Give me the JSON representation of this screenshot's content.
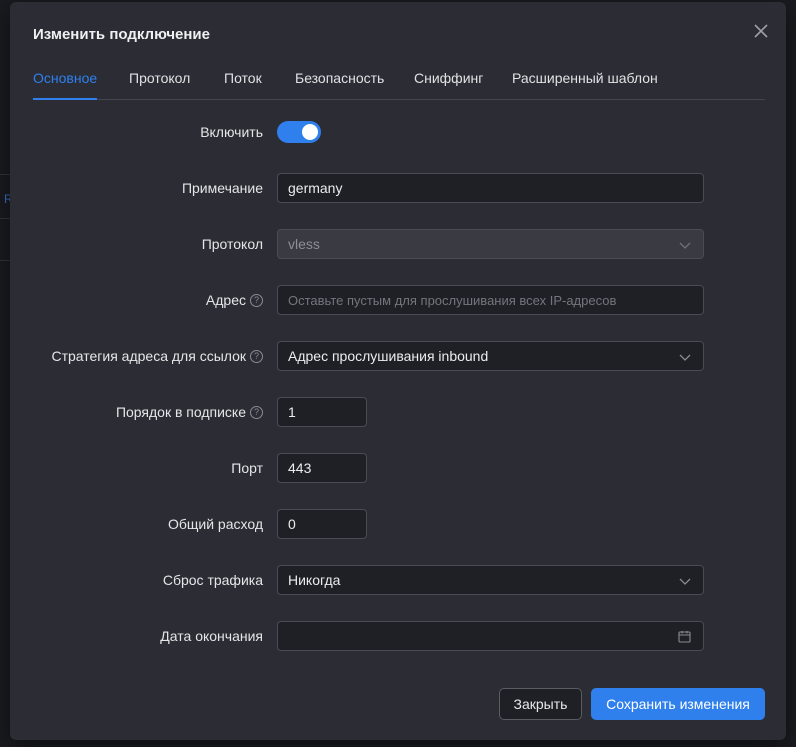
{
  "background": {
    "glyph": "R"
  },
  "modal": {
    "title": "Изменить подключение",
    "tabs": [
      {
        "label": "Основное",
        "active": true
      },
      {
        "label": "Протокол",
        "active": false
      },
      {
        "label": "Поток",
        "active": false
      },
      {
        "label": "Безопасность",
        "active": false
      },
      {
        "label": "Сниффинг",
        "active": false
      },
      {
        "label": "Расширенный шаблон",
        "active": false
      }
    ],
    "form": {
      "enable": {
        "label": "Включить",
        "value": true
      },
      "remark": {
        "label": "Примечание",
        "value": "germany"
      },
      "protocol": {
        "label": "Протокол",
        "value": "vless",
        "disabled": true
      },
      "address": {
        "label": "Адрес",
        "placeholder": "Оставьте пустым для прослушивания всех IP-адресов",
        "value": ""
      },
      "link_strategy": {
        "label": "Стратегия адреса для ссылок",
        "value": "Адрес прослушивания inbound"
      },
      "sub_order": {
        "label": "Порядок в подписке",
        "value": "1"
      },
      "port": {
        "label": "Порт",
        "value": "443"
      },
      "total_usage": {
        "label": "Общий расход",
        "value": "0"
      },
      "traffic_reset": {
        "label": "Сброс трафика",
        "value": "Никогда"
      },
      "expiry": {
        "label": "Дата окончания",
        "value": ""
      }
    },
    "buttons": {
      "close": "Закрыть",
      "save": "Сохранить изменения"
    }
  },
  "colors": {
    "accent": "#2f80ed",
    "modal_bg": "#2b2c34",
    "input_bg": "#1f2026"
  },
  "icons": [
    "close-icon",
    "help-icon",
    "chevron-down-icon",
    "calendar-icon"
  ]
}
